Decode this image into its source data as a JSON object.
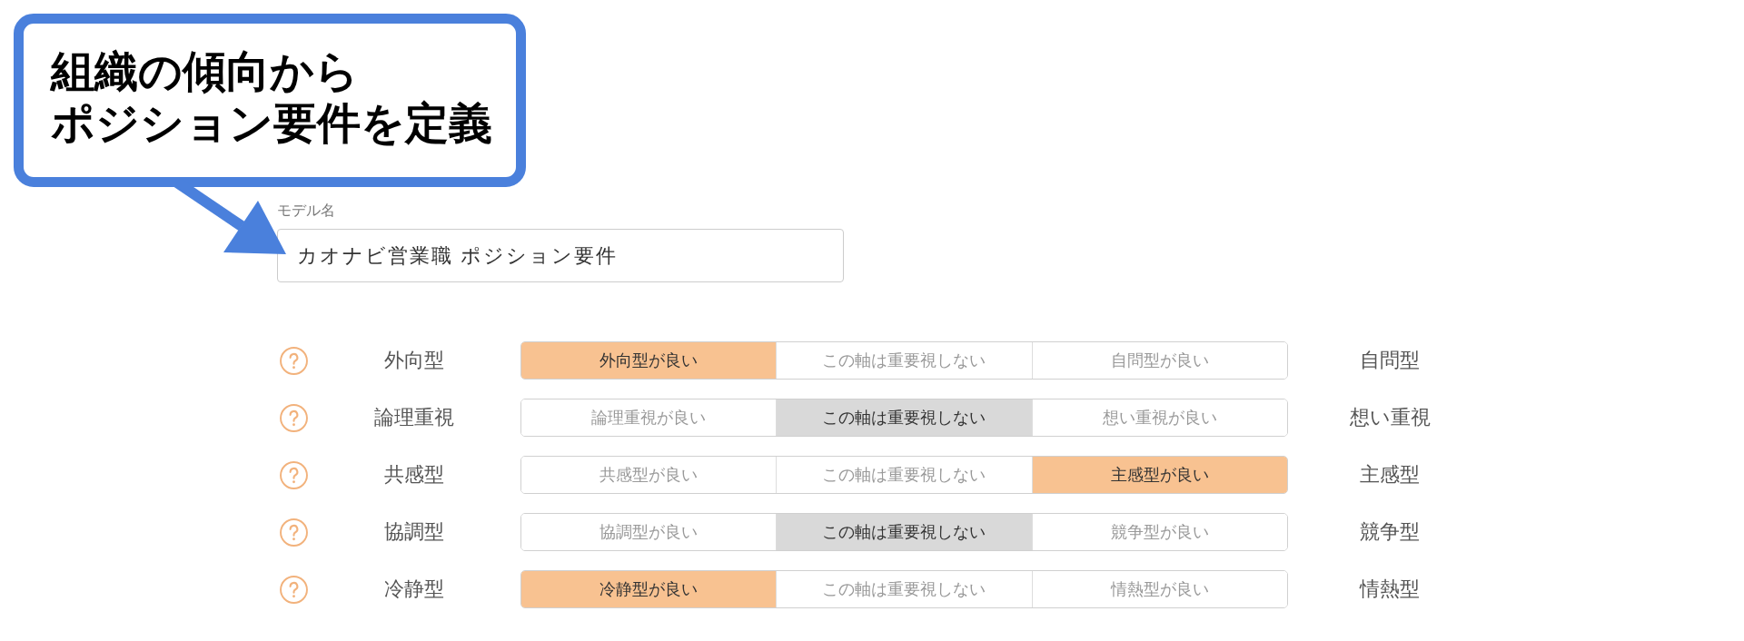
{
  "callout": {
    "text_lines": [
      "組織の傾向から",
      "ポジション要件を定義"
    ]
  },
  "model_name": {
    "label": "モデル名",
    "value": "カオナビ営業職 ポジション要件"
  },
  "axes": [
    {
      "left_label": "外向型",
      "options": [
        {
          "label": "外向型が良い",
          "selected": true
        },
        {
          "label": "この軸は重要視しない",
          "selected": false
        },
        {
          "label": "自問型が良い",
          "selected": false
        }
      ],
      "right_label": "自問型"
    },
    {
      "left_label": "論理重視",
      "options": [
        {
          "label": "論理重視が良い",
          "selected": false
        },
        {
          "label": "この軸は重要視しない",
          "selected": true
        },
        {
          "label": "想い重視が良い",
          "selected": false
        }
      ],
      "right_label": "想い重視"
    },
    {
      "left_label": "共感型",
      "options": [
        {
          "label": "共感型が良い",
          "selected": false
        },
        {
          "label": "この軸は重要視しない",
          "selected": false
        },
        {
          "label": "主感型が良い",
          "selected": true
        }
      ],
      "right_label": "主感型"
    },
    {
      "left_label": "協調型",
      "options": [
        {
          "label": "協調型が良い",
          "selected": false
        },
        {
          "label": "この軸は重要視しない",
          "selected": true
        },
        {
          "label": "競争型が良い",
          "selected": false
        }
      ],
      "right_label": "競争型"
    },
    {
      "left_label": "冷静型",
      "options": [
        {
          "label": "冷静型が良い",
          "selected": true
        },
        {
          "label": "この軸は重要視しない",
          "selected": false
        },
        {
          "label": "情熱型が良い",
          "selected": false
        }
      ],
      "right_label": "情熱型"
    }
  ]
}
